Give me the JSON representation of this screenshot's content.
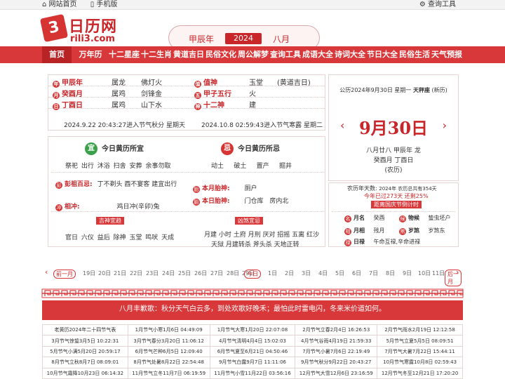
{
  "topbar": {
    "home": "网站首页",
    "mobile": "手机版",
    "tools": "查询工具"
  },
  "logo": {
    "mark": "3",
    "cn": "日历网",
    "en": "rili3.com"
  },
  "year": {
    "ganzhi": "甲辰年",
    "year": "2024",
    "month": "八月"
  },
  "nav": [
    "首页",
    "万年历",
    "十二星座",
    "十二生肖",
    "黄道吉日",
    "民俗文化",
    "周公解梦",
    "查询工具",
    "成语大全",
    "诗词大全",
    "节日大全",
    "民俗生活",
    "天气预报"
  ],
  "left": {
    "rows": [
      {
        "c1": "甲辰年",
        "c1i": "年",
        "c2": "属龙",
        "c3": "佛灯火",
        "c4": "值神",
        "c4i": "值",
        "c5": "玉堂",
        "c6": "(黄道吉日)"
      },
      {
        "c1": "癸酉月",
        "c1i": "月",
        "c2": "属鸡",
        "c3": "剑锋金",
        "c4": "甲子五行",
        "c4i": "五",
        "c5": "火",
        "c6": ""
      },
      {
        "c1": "丁酉日",
        "c1i": "日",
        "c2": "属鸡",
        "c3": "山下水",
        "c4": "十二神",
        "c4i": "神",
        "c5": "建",
        "c6": ""
      }
    ],
    "jq1": "2024.9.22 20:43:27进入节气秋分 星期天",
    "jq2": "2024.10.8 02:59:43进入节气寒露 星期二"
  },
  "right": {
    "line1": "公历2024年9月30日 星期一",
    "xingzuo": "天秤座",
    "xinli": "(新历)",
    "big": "9月30日",
    "prev": "‹",
    "next": "›",
    "l1": "八月廿八 甲辰年 龙",
    "l2": "癸酉月 丁酉日",
    "l3": "(农历)"
  },
  "yi": {
    "title": "今日黄历所宜",
    "icon": "宜",
    "items": [
      "祭祀",
      "出行",
      "沐浴",
      "扫舍",
      "安葬",
      "余事勿取"
    ]
  },
  "ji": {
    "title": "今日黄历所忌",
    "icon": "忌",
    "items": [
      "动土",
      "破土",
      "置产",
      "掘井"
    ]
  },
  "pz": {
    "label": "彭祖百忌:",
    "v1": "丁不剃头",
    "v2": "酉不宴客",
    "v3": "建宜出行"
  },
  "xc": {
    "label": "相冲:",
    "v": "鸡日冲(辛卯)兔"
  },
  "taishen": {
    "label": "本月胎神:",
    "v": "厕户"
  },
  "taishen2": {
    "label": "本日胎神:",
    "v": "门仓库",
    "v2": "房内北"
  },
  "jishen": {
    "title": "吉神宜趋",
    "items": "官日 六仪 益后 除神 玉堂 鸣吠 天成"
  },
  "xiongsha": {
    "title": "凶煞宜忌",
    "line1": "月建 小时 土府 月刑 厌对 招摇 五离 红沙",
    "line2": "天狱 月建转杀 斧头杀 天地正转"
  },
  "info2": {
    "l1a": "农历年天数:",
    "l1b": "2024年 农历总共有354天",
    "l2": "今年已过273天 还剩25%",
    "l3": "距离国庆节倒计时",
    "rows": [
      {
        "k": "月名",
        "v": "癸酉",
        "k2": "物候",
        "v2": "蛰虫坯户"
      },
      {
        "k": "月相",
        "v": "残月",
        "k2": "岁煞",
        "v2": "岁煞东"
      },
      {
        "k": "日禄",
        "v": "午命互禄,辛命进禄",
        "k2": "",
        "v2": ""
      }
    ]
  },
  "datebar": {
    "prev": "前一月",
    "dates": [
      "19日",
      "20日",
      "21日",
      "22日",
      "23日",
      "24日",
      "25日",
      "26日",
      "27日",
      "28日",
      "29日",
      "今日",
      "1日",
      "2日",
      "3日",
      "4日",
      "5日",
      "6日",
      "7日",
      "8日",
      "9日",
      "10日",
      "11日"
    ],
    "next": "后一月"
  },
  "banner": "八月丰歉歌：秋分天气白云多，到处欢歌好晚禾；最怕此时雷电闪，冬来米价道如何。",
  "jieqi": [
    [
      "老黄历2024年二十四节气表",
      "1月节气小寒1月6日 04:49:09",
      "1月节气大寒1月20日 22:07:08",
      "2月节气立春2月4日 16:26:53",
      "2月节气雨水2月19日 12:12:58"
    ],
    [
      "3月节气惊蛰3月5日 10:22:31",
      "3月节气春分3月20日 11:06:12",
      "4月节气清明4月4日 15:02:03",
      "4月节气谷雨4月19日 21:59:33",
      "5月节气立夏5月5日 08:09:51"
    ],
    [
      "5月节气小满5月20日 20:59:17",
      "6月节气芒种6月5日 12:09:40",
      "6月节气夏至6月21日 04:50:46",
      "7月节气小暑7月6日 22:19:49",
      "7月节气大暑7月22日 15:44:11"
    ],
    [
      "8月节气立秋8月7日 08:09:01",
      "8月节气处暑8月22日 22:54:48",
      "9月节气白露9月7日 11:11:06",
      "9月节气秋分9月22日 20:43:27",
      "10月节气寒露10月8日 02:59:43"
    ],
    [
      "10月节气霜降10月23日 06:14:32",
      "11月节气立冬11月7日 06:19:59",
      "11月节气小雪11月22日 03:56:16",
      "12月节气大雪12月6日 23:16:59",
      "12月节气冬至12月21日 17:20:20"
    ]
  ]
}
